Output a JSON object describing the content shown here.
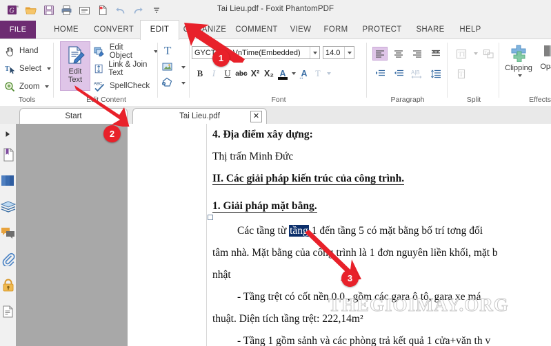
{
  "window": {
    "title": "Tai Lieu.pdf - Foxit PhantomPDF"
  },
  "quick_access": {
    "items": [
      {
        "name": "foxit-logo-icon",
        "label": "Foxit"
      },
      {
        "name": "open-folder-icon",
        "label": "Open"
      },
      {
        "name": "save-icon",
        "label": "Save"
      },
      {
        "name": "print-icon",
        "label": "Print"
      },
      {
        "name": "email-icon",
        "label": "Email"
      },
      {
        "name": "new-document-icon",
        "label": "Create PDF"
      },
      {
        "name": "undo-icon",
        "label": "Undo"
      },
      {
        "name": "redo-icon",
        "label": "Redo"
      },
      {
        "name": "customize-toolbar-icon",
        "label": "Customize"
      }
    ]
  },
  "ribbon_tabs": [
    {
      "label": "FILE",
      "active": false
    },
    {
      "label": "HOME",
      "active": false
    },
    {
      "label": "CONVERT",
      "active": false
    },
    {
      "label": "EDIT",
      "active": true
    },
    {
      "label": "ORGANIZE",
      "active": false
    },
    {
      "label": "COMMENT",
      "active": false
    },
    {
      "label": "VIEW",
      "active": false
    },
    {
      "label": "FORM",
      "active": false
    },
    {
      "label": "PROTECT",
      "active": false
    },
    {
      "label": "SHARE",
      "active": false
    },
    {
      "label": "HELP",
      "active": false
    }
  ],
  "ribbon": {
    "tools": {
      "group_label": "Tools",
      "hand": "Hand",
      "select": "Select",
      "zoom": "Zoom"
    },
    "edit_content": {
      "group_label": "Edit Content",
      "edit_text_line1": "Edit",
      "edit_text_line2": "Text",
      "edit_object": "Edit Object",
      "link_join_text": "Link & Join Text",
      "spellcheck": "SpellCheck"
    },
    "font": {
      "group_label": "Font",
      "family_value": "GYCTITIM.VnTime(Embedded)",
      "size_value": "14.0",
      "bold": "B",
      "italic": "I",
      "underline": "U",
      "strikethrough": "abc",
      "superscript": "X²",
      "subscript": "X₂",
      "font_color": "A",
      "char_spacing": "A",
      "text_transform": "T"
    },
    "paragraph": {
      "group_label": "Paragraph",
      "align_left": "align-left",
      "align_center": "align-center",
      "align_right": "align-right",
      "align_justify": "align-justify",
      "indent_increase": "indent-increase",
      "indent_decrease": "indent-decrease",
      "horizontal_scale": "A|B",
      "line_spacing": "line-spacing"
    },
    "split": {
      "group_label": "Split",
      "split_horizontal": "split-horizontal",
      "split_grid": "split-grid",
      "split_vertical": "split-vertical"
    },
    "effects": {
      "group_label": "Effects",
      "clipping": "Clipping",
      "opacity": "Opacity"
    }
  },
  "doc_tabs": [
    {
      "label": "Start",
      "closable": false,
      "active": false
    },
    {
      "label": "Tai Lieu.pdf",
      "closable": true,
      "active": true,
      "close_label": "✕"
    }
  ],
  "left_rail": {
    "expand_label": "▶",
    "items": [
      {
        "name": "bookmarks-icon",
        "label": "Bookmarks"
      },
      {
        "name": "page-thumbnails-icon",
        "label": "Page Thumbnails"
      },
      {
        "name": "layers-icon",
        "label": "Layers"
      },
      {
        "name": "comments-icon",
        "label": "Comments"
      },
      {
        "name": "attachments-icon",
        "label": "Attachments"
      },
      {
        "name": "security-lock-icon",
        "label": "Security"
      },
      {
        "name": "digital-signature-icon",
        "label": "Digital Signatures"
      }
    ]
  },
  "document": {
    "lines": [
      {
        "id": "l1",
        "text": "4. Địa điểm xây dựng:",
        "bold": true,
        "underline": false
      },
      {
        "id": "l2",
        "text": "Thị trấn Minh Đức",
        "bold": false,
        "underline": false
      },
      {
        "id": "l3",
        "text": "II. Các giải pháp kiến trúc của công trình.",
        "bold": true,
        "underline": true
      },
      {
        "id": "l4",
        "text": "1. Giải pháp mặt bằng.",
        "bold": true,
        "underline": true
      },
      {
        "id": "l5a",
        "text": "Các tầng từ ",
        "bold": false
      },
      {
        "id": "l5sel",
        "text": "tầng",
        "selected": true
      },
      {
        "id": "l5b",
        "text": " 1 đến tầng 5 có mặt bằng bố trí t­ơng đối",
        "bold": false
      },
      {
        "id": "l6",
        "text": "tâm nhà. Mặt bằng của công trình là 1 đơn nguyên liền khối, mặt b",
        "bold": false
      },
      {
        "id": "l7",
        "text": "nhật",
        "bold": false
      },
      {
        "id": "l8",
        "text": "-  Tầng trệt có cốt nền 0.0 , gồm các gara ô tô, gara xe má",
        "bold": false
      },
      {
        "id": "l9",
        "text": "thuật. Diện tích tầng trệt: 222,14m²",
        "bold": false
      },
      {
        "id": "l10",
        "text": "- Tầng 1 gồm sảnh và các phòng trả kết quả 1 cửa+văn th­ v",
        "bold": false
      }
    ],
    "watermark": "THEGIOIMAY.ORG"
  },
  "callouts": [
    {
      "number": "1",
      "target": "font-family-field"
    },
    {
      "number": "2",
      "target": "edit-text-button"
    },
    {
      "number": "3",
      "target": "selected-word-in-document"
    }
  ],
  "colors": {
    "accent_purple": "#6d2c72",
    "selected_fill": "#dfc5e8",
    "callout_red": "#e8212a",
    "text_selection_blue": "#0b2f6b",
    "nav_pane_gray": "#a8a8a8"
  }
}
